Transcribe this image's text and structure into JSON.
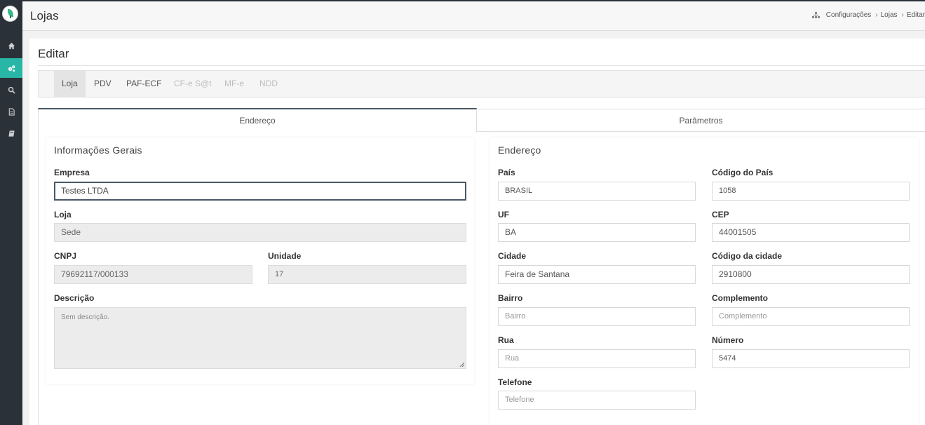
{
  "header": {
    "title": "Lojas",
    "breadcrumb": [
      "Configurações",
      "Lojas",
      "Editar"
    ]
  },
  "sidebar": {
    "items": [
      {
        "icon": "home-icon"
      },
      {
        "icon": "settings-icon",
        "active": true
      },
      {
        "icon": "search-icon"
      },
      {
        "icon": "document-icon"
      },
      {
        "icon": "book-icon"
      }
    ]
  },
  "panel": {
    "title": "Editar",
    "tabs": [
      {
        "label": "Loja",
        "active": true
      },
      {
        "label": "PDV"
      },
      {
        "label": "PAF-ECF"
      },
      {
        "label": "CF-e S@t",
        "disabled": true
      },
      {
        "label": "MF-e",
        "disabled": true
      },
      {
        "label": "NDD",
        "disabled": true
      }
    ],
    "subtabs": [
      "Endereço",
      "Parâmetros"
    ]
  },
  "general": {
    "title": "Informações Gerais",
    "empresa_label": "Empresa",
    "empresa_value": "Testes LTDA",
    "loja_label": "Loja",
    "loja_value": "Sede",
    "cnpj_label": "CNPJ",
    "cnpj_value": "79692117/000133",
    "unidade_label": "Unidade",
    "unidade_value": "17",
    "descricao_label": "Descrição",
    "descricao_placeholder": "Sem descrição."
  },
  "address": {
    "title": "Endereço",
    "pais_label": "País",
    "pais_value": "BRASIL",
    "codigo_pais_label": "Código do País",
    "codigo_pais_value": "1058",
    "uf_label": "UF",
    "uf_value": "BA",
    "cep_label": "CEP",
    "cep_value": "44001505",
    "cidade_label": "Cidade",
    "cidade_value": "Feira de Santana",
    "codigo_cidade_label": "Código da cidade",
    "codigo_cidade_value": "2910800",
    "bairro_label": "Bairro",
    "bairro_placeholder": "Bairro",
    "complemento_label": "Complemento",
    "complemento_placeholder": "Complemento",
    "rua_label": "Rua",
    "rua_placeholder": "Rua",
    "numero_label": "Número",
    "numero_value": "5474",
    "telefone_label": "Telefone",
    "telefone_placeholder": "Telefone"
  },
  "colors": {
    "sidebar": "#2b3138",
    "accent": "#28b7a7",
    "focus_border": "#4a5966"
  }
}
